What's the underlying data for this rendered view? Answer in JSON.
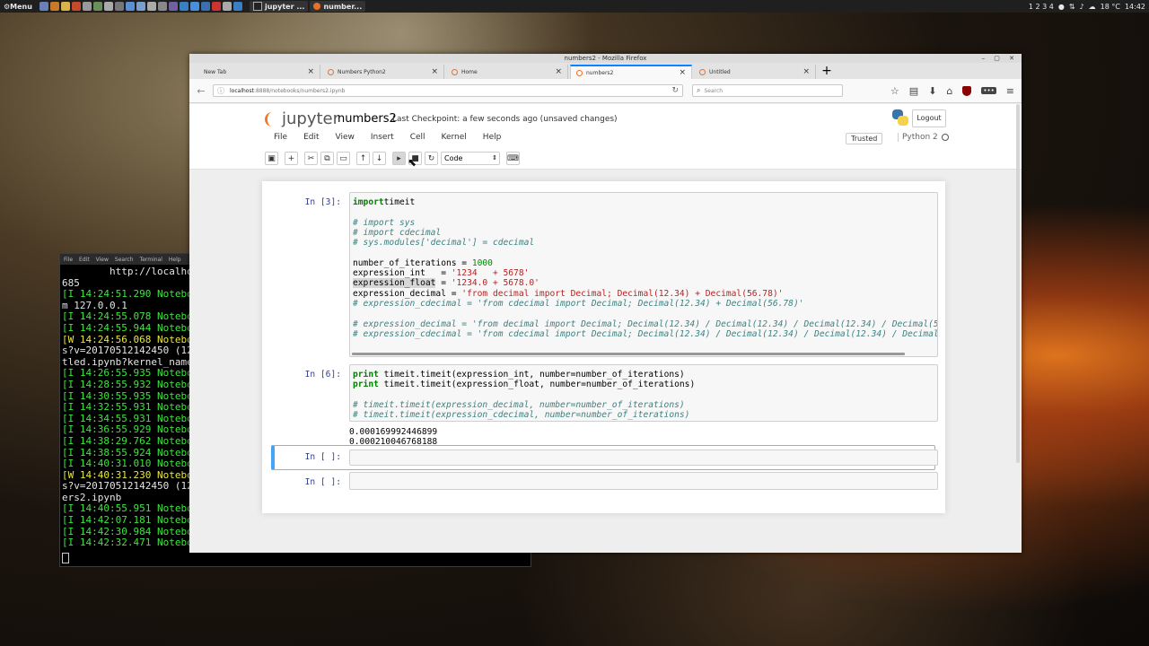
{
  "panel": {
    "menu_label": "Menu",
    "tasks": [
      "jupyter ...",
      "number..."
    ],
    "workspaces": "1 2 3 4",
    "weather": "18 °C",
    "clock": "14:42"
  },
  "terminal": {
    "menu": [
      "File",
      "Edit",
      "View",
      "Search",
      "Terminal",
      "Help"
    ],
    "lines": [
      {
        "text": "        http://localhos",
        "color": "white"
      },
      {
        "text": "685",
        "color": "white"
      },
      {
        "text": "[I 14:24:51.290 Notebo",
        "color": "green"
      },
      {
        "text": "m 127.0.0.1",
        "color": "white"
      },
      {
        "text": "[I 14:24:55.078 Notebo",
        "color": "green"
      },
      {
        "text": "[I 14:24:55.944 Notebo",
        "color": "green"
      },
      {
        "text": "[W 14:24:56.068 Notebo",
        "color": "yellow"
      },
      {
        "text": "s?v=20170512142450 (12",
        "color": "white"
      },
      {
        "text": "tled.ipynb?kernel_name=",
        "color": "white"
      },
      {
        "text": "[I 14:26:55.935 Notebo",
        "color": "green"
      },
      {
        "text": "[I 14:28:55.932 Notebo",
        "color": "green"
      },
      {
        "text": "[I 14:30:55.935 Notebo",
        "color": "green"
      },
      {
        "text": "[I 14:32:55.931 Notebo",
        "color": "green"
      },
      {
        "text": "[I 14:34:55.931 Notebo",
        "color": "green"
      },
      {
        "text": "[I 14:36:55.929 Notebo",
        "color": "green"
      },
      {
        "text": "[I 14:38:29.762 Notebo",
        "color": "green"
      },
      {
        "text": "[I 14:38:55.924 Notebo",
        "color": "green"
      },
      {
        "text": "[I 14:40:31.010 Notebo",
        "color": "green"
      },
      {
        "text": "[W 14:40:31.230 Notebo",
        "color": "yellow"
      },
      {
        "text": "s?v=20170512142450 (12",
        "color": "white"
      },
      {
        "text": "ers2.ipynb",
        "color": "white"
      },
      {
        "text": "[I 14:40:55.951 Notebo",
        "color": "green"
      },
      {
        "text": "[I 14:42:07.181 Notebo",
        "color": "green"
      },
      {
        "text": "[I 14:42:30.984 Notebo",
        "color": "green"
      },
      {
        "text": "[I 14:42:32.471 Notebo",
        "color": "green"
      }
    ]
  },
  "browser": {
    "window_title": "numbers2 - Mozilla Firefox",
    "tabs": [
      {
        "label": "New Tab",
        "active": false,
        "icon": false
      },
      {
        "label": "Numbers Python2",
        "active": false,
        "icon": true
      },
      {
        "label": "Home",
        "active": false,
        "icon": true
      },
      {
        "label": "numbers2",
        "active": true,
        "icon": true
      },
      {
        "label": "Untitled",
        "active": false,
        "icon": true
      }
    ],
    "url_host": "localhost",
    "url_path": ":8888/notebooks/numbers2.ipynb",
    "search_placeholder": "Search"
  },
  "jupyter": {
    "logo_text": "jupyter",
    "notebook_name": "numbers2",
    "checkpoint": "Last Checkpoint: a few seconds ago (unsaved changes)",
    "logout": "Logout",
    "menu": [
      "File",
      "Edit",
      "View",
      "Insert",
      "Cell",
      "Kernel",
      "Help"
    ],
    "trusted": "Trusted",
    "kernel_name": "Python 2",
    "cell_type": "Code"
  },
  "cells": {
    "c1": {
      "prompt": "In [3]:",
      "lines": [
        [
          [
            "kw",
            "import"
          ],
          [
            "",
            "timeit"
          ]
        ],
        [
          [
            "",
            ""
          ]
        ],
        [
          [
            "cm",
            "# import sys"
          ]
        ],
        [
          [
            "cm",
            "# import cdecimal"
          ]
        ],
        [
          [
            "cm",
            "# sys.modules['decimal'] = cdecimal"
          ]
        ],
        [
          [
            "",
            ""
          ]
        ],
        [
          [
            "",
            "number_of_iterations = "
          ],
          [
            "nm",
            "1000"
          ]
        ],
        [
          [
            "",
            "expression_int   = "
          ],
          [
            "st",
            "'1234   + 5678'"
          ]
        ],
        [
          [
            "hl",
            "expression_float"
          ],
          [
            "",
            " = "
          ],
          [
            "st",
            "'1234.0 + 5678.0'"
          ]
        ],
        [
          [
            "",
            "expression_decimal = "
          ],
          [
            "st",
            "'from decimal import Decimal; Decimal(12.34) + Decimal(56.78)'"
          ]
        ],
        [
          [
            "cm",
            "# expression_cdecimal = 'from cdecimal import Decimal; Decimal(12.34) + Decimal(56.78)'"
          ]
        ],
        [
          [
            "",
            ""
          ]
        ],
        [
          [
            "cm",
            "# expression_decimal = 'from decimal import Decimal; Decimal(12.34) / Decimal(12.34) / Decimal(12.34) / Decimal(56."
          ]
        ],
        [
          [
            "cm",
            "# expression_cdecimal = 'from cdecimal import Decimal; Decimal(12.34) / Decimal(12.34) / Decimal(12.34) / Decimal(5"
          ]
        ]
      ]
    },
    "c2": {
      "prompt": "In [6]:",
      "lines": [
        [
          [
            "kw",
            "print"
          ],
          [
            "",
            " timeit.timeit(expression_int, number=number_of_iterations)"
          ]
        ],
        [
          [
            "kw",
            "print"
          ],
          [
            "",
            " timeit.timeit(expression_float, number=number_of_iterations)"
          ]
        ],
        [
          [
            "",
            ""
          ]
        ],
        [
          [
            "cm",
            "# timeit.timeit(expression_decimal, number=number_of_iterations)"
          ]
        ],
        [
          [
            "cm",
            "# timeit.timeit(expression_cdecimal, number=number_of_iterations)"
          ]
        ]
      ],
      "output": [
        "0.000169992446899",
        "0.000210046768188"
      ]
    },
    "c3": {
      "prompt": "In [ ]:"
    },
    "c4": {
      "prompt": "In [ ]:"
    }
  }
}
